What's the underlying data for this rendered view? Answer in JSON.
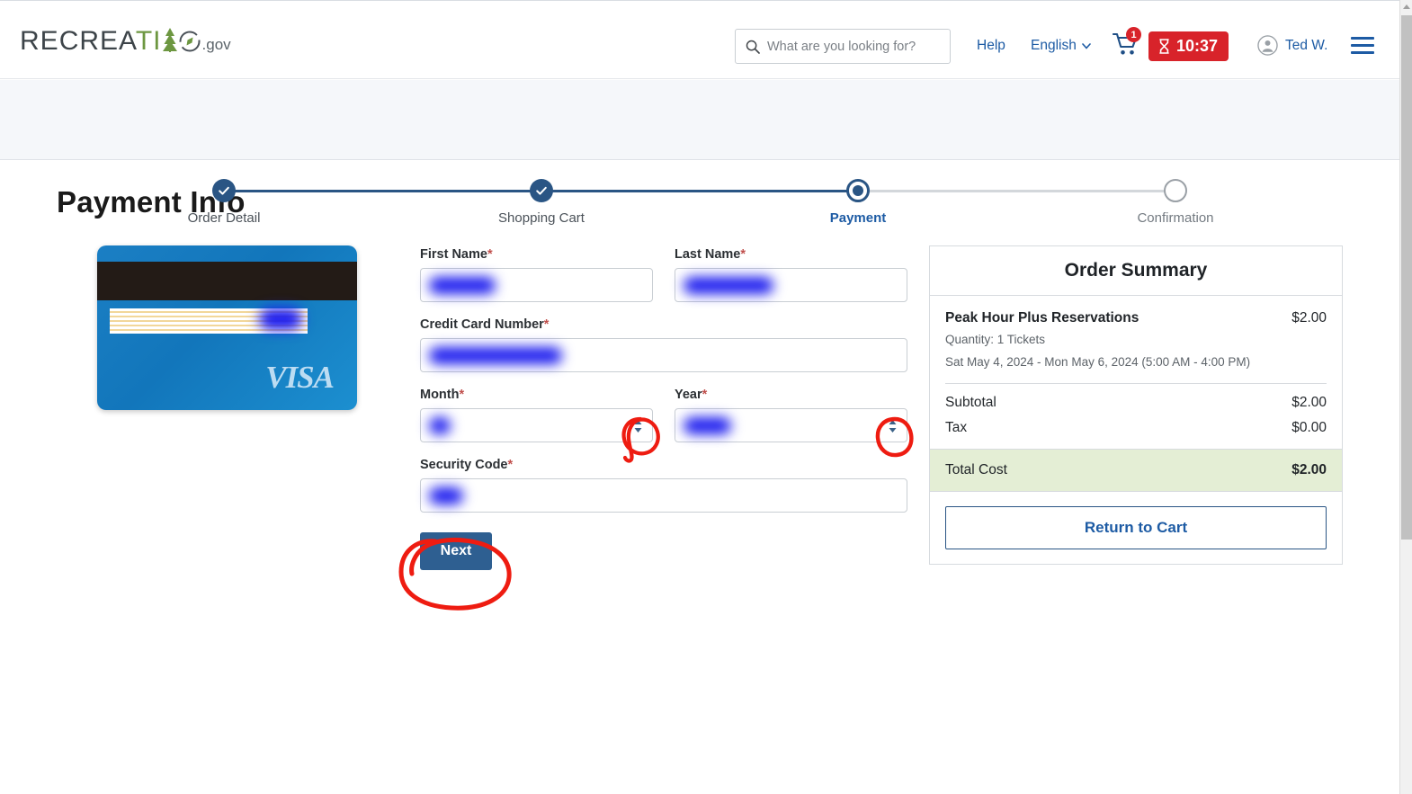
{
  "header": {
    "logo": {
      "text_main": "RECREATION",
      "text_sub": ".gov"
    },
    "search": {
      "placeholder": "What are you looking for?",
      "value": ""
    },
    "help_label": "Help",
    "language_label": "English",
    "cart_badge": "1",
    "timer_label": "10:37",
    "user_label": "Ted W."
  },
  "stepper": {
    "steps": [
      {
        "label": "Order Detail",
        "state": "done"
      },
      {
        "label": "Shopping Cart",
        "state": "done"
      },
      {
        "label": "Payment",
        "state": "current"
      },
      {
        "label": "Confirmation",
        "state": "todo"
      }
    ]
  },
  "main": {
    "page_title": "Payment Info",
    "card": {
      "brand": "VISA"
    },
    "form": {
      "first_name": {
        "label": "First Name",
        "required": "*",
        "value_redacted": true
      },
      "last_name": {
        "label": "Last Name",
        "required": "*",
        "value_redacted": true
      },
      "credit_card_number": {
        "label": "Credit Card Number",
        "required": "*",
        "value_redacted": true
      },
      "month": {
        "label": "Month",
        "required": "*",
        "value_redacted": true
      },
      "year": {
        "label": "Year",
        "required": "*",
        "value_redacted": true
      },
      "security_code": {
        "label": "Security Code",
        "required": "*",
        "value_redacted": true
      },
      "submit_label": "Next"
    }
  },
  "summary": {
    "title": "Order Summary",
    "item": {
      "name": "Peak Hour Plus Reservations",
      "price": "$2.00",
      "quantity": "Quantity: 1 Tickets",
      "dates": "Sat May 4, 2024 - Mon May 6, 2024 (5:00 AM - 4:00 PM)"
    },
    "lines": [
      {
        "label": "Subtotal",
        "value": "$2.00"
      },
      {
        "label": "Tax",
        "value": "$0.00"
      }
    ],
    "total": {
      "label": "Total Cost",
      "value": "$2.00"
    },
    "return_label": "Return to Cart"
  },
  "colors": {
    "brand_blue": "#1d5ba4",
    "step_blue": "#2a5584",
    "alert_red": "#d8232a",
    "annotation_red": "#ee1c11",
    "total_green_bg": "#e4eed5",
    "redaction_blue": "#1a1aee",
    "logo_green": "#6d9741"
  }
}
